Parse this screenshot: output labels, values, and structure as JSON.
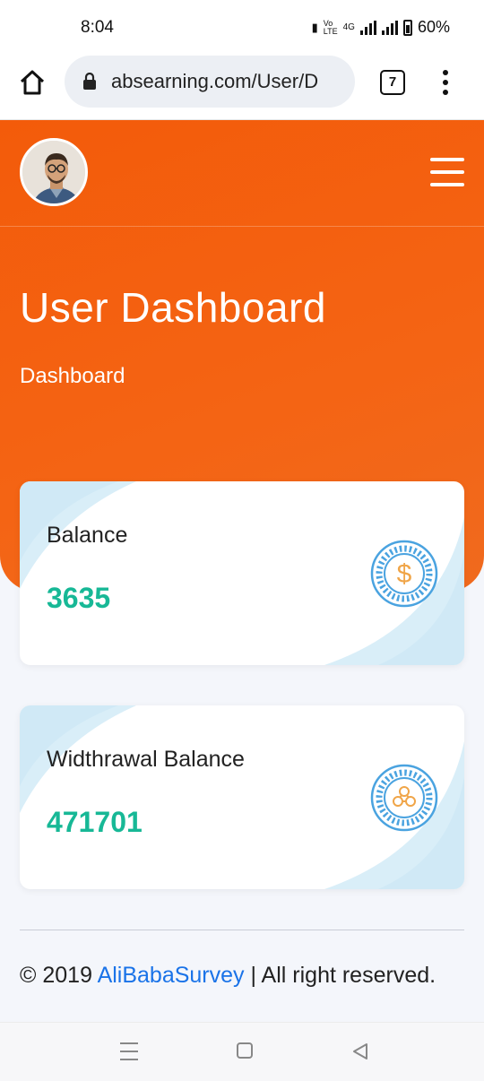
{
  "status_bar": {
    "time": "8:04",
    "battery": "60%",
    "network_label": "4G"
  },
  "browser": {
    "url": "absearning.com/User/D",
    "tab_count": "7"
  },
  "header": {
    "title": "User Dashboard",
    "breadcrumb": "Dashboard"
  },
  "cards": [
    {
      "label": "Balance",
      "value": "3635",
      "icon": "dollar-coin-icon"
    },
    {
      "label": "Widthrawal Balance",
      "value": "471701",
      "icon": "ripple-coin-icon"
    }
  ],
  "footer": {
    "prefix": "© 2019 ",
    "link": "AliBabaSurvey",
    "suffix": " | All right reserved."
  },
  "colors": {
    "accent": "#f35b0a",
    "value": "#17b896",
    "link": "#1a73e8",
    "icon": "#4aa3e0",
    "coin_symbol": "#f0a548"
  }
}
